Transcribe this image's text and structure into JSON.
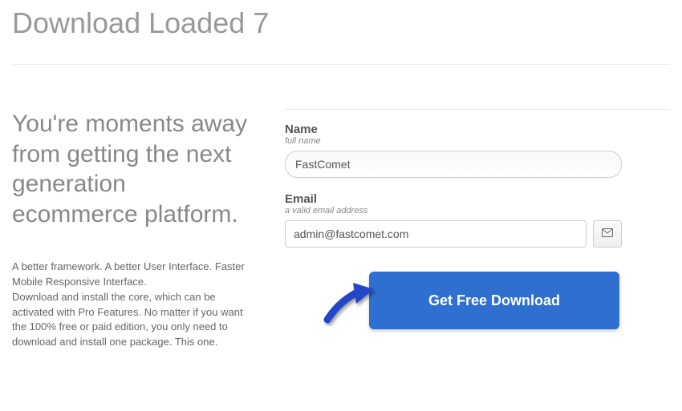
{
  "page_title": "Download Loaded 7",
  "left": {
    "headline": "You're moments away from getting the next generation ecommerce platform.",
    "description_line1": "A better framework. A better User Interface. Faster Mobile Responsive Interface.",
    "description_line2": "Download and install the core, which can be activated with Pro Features. No matter if you want the 100% free or paid edition, you only need to download and install one package. This one."
  },
  "form": {
    "name_label": "Name",
    "name_hint": "full name",
    "name_value": "FastComet",
    "email_label": "Email",
    "email_hint": "a valid email address",
    "email_value": "admin@fastcomet.com",
    "submit_label": "Get Free Download"
  }
}
